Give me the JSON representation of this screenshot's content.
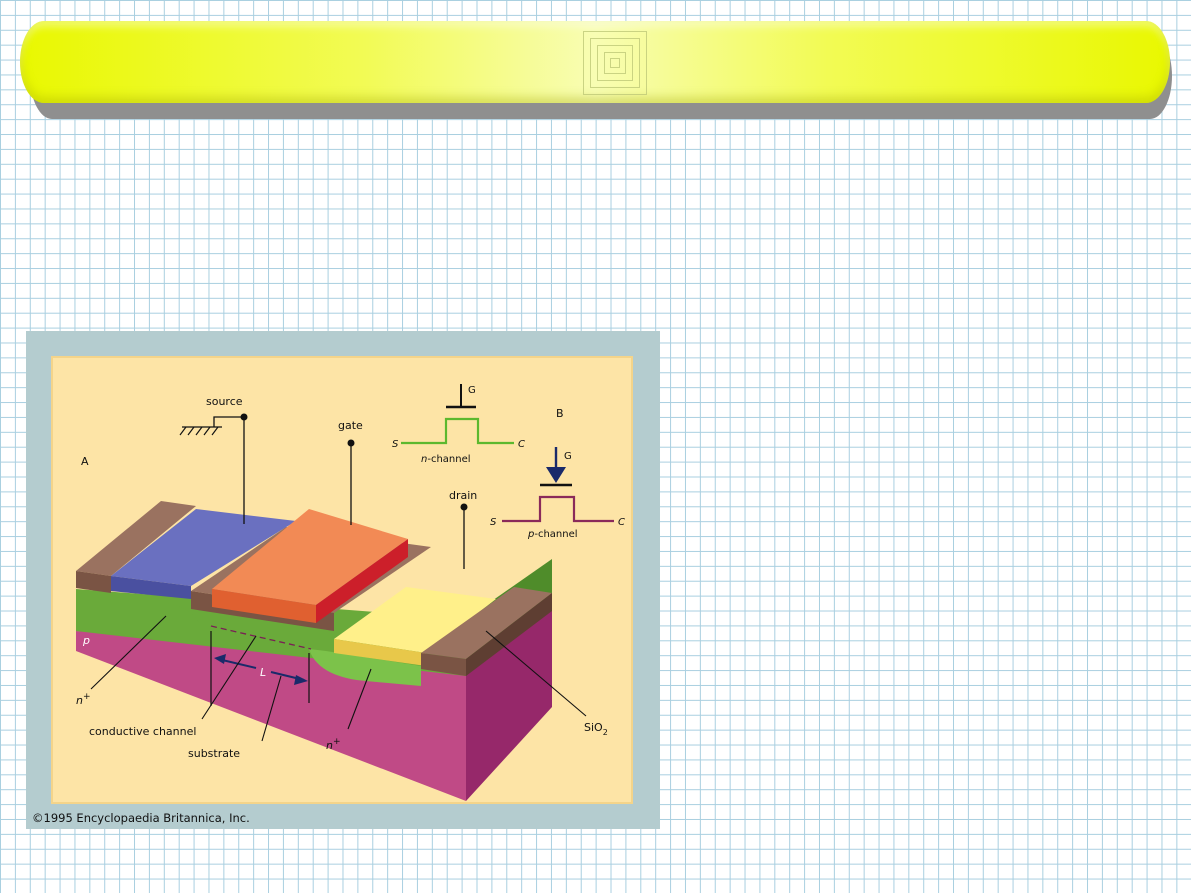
{
  "diagram": {
    "panel_a_label": "A",
    "panel_b_label": "B",
    "labels": {
      "source": "source",
      "gate": "gate",
      "drain": "drain",
      "p_region": "p",
      "n_plus": "n",
      "n_plus_right": "n",
      "plus": "+",
      "channel_length": "L",
      "conductive_channel": "conductive channel",
      "substrate": "substrate",
      "sio2": "SiO",
      "sio2_sub": "2"
    },
    "n_channel_symbol": {
      "gate": "G",
      "source": "S",
      "collector": "C",
      "caption_italic": "n",
      "caption_rest": "-channel",
      "color": "#5cb82e"
    },
    "p_channel_symbol": {
      "gate": "G",
      "source": "S",
      "collector": "C",
      "caption_italic": "p",
      "caption_rest": "-channel",
      "color": "#8a2a5a"
    },
    "copyright": "©1995 Encyclopaedia Britannica, Inc."
  }
}
